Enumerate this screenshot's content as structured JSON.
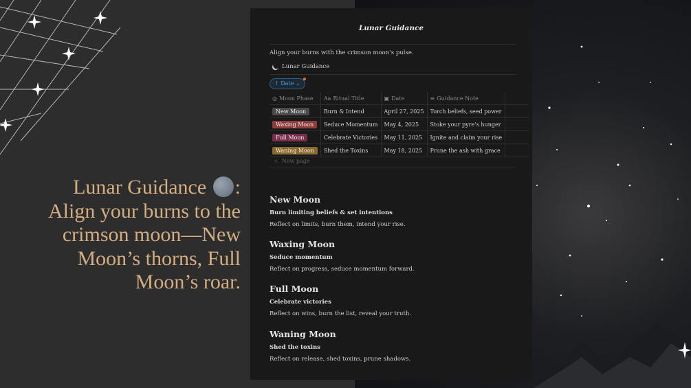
{
  "headline": {
    "line1": "Lunar Guidance",
    "line1_suffix": ":",
    "line2": "Align your burns to the",
    "line3": "crimson moon—New",
    "line4": "Moon’s thorns, Full",
    "line5": "Moon’s roar."
  },
  "panel": {
    "title": "Lunar Guidance",
    "description": "Align your burns with the crimson moon’s pulse.",
    "db_title": "Lunar Guidance",
    "filter_label": "↑ Date ⌄",
    "columns": [
      "Moon Phase",
      "Ritual Title",
      "Date",
      "Guidance Note"
    ],
    "column_icons": [
      "target-icon",
      "text-icon",
      "calendar-icon",
      "lines-icon"
    ],
    "rows": [
      {
        "phase": "New Moon",
        "phase_color": "#4a4a4a",
        "title": "Burn & Intend",
        "date": "April 27, 2025",
        "note": "Torch beliefs, seed power"
      },
      {
        "phase": "Waxing Moon",
        "phase_color": "#8f3b3b",
        "title": "Seduce Momentum",
        "date": "May 4, 2025",
        "note": "Stoke your pyre’s hunger"
      },
      {
        "phase": "Full Moon",
        "phase_color": "#7a2d4a",
        "title": "Celebrate Victories",
        "date": "May 11, 2025",
        "note": "Ignite and claim your rise"
      },
      {
        "phase": "Waning Moon",
        "phase_color": "#8a6a2c",
        "title": "Shed the Toxins",
        "date": "May 18, 2025",
        "note": "Prune the ash with grace"
      }
    ],
    "new_page": "New page",
    "sections": [
      {
        "heading": "New Moon",
        "sub": "Burn limiting beliefs & set intentions",
        "text": "Reflect on limits, burn them, intend your rise."
      },
      {
        "heading": "Waxing Moon",
        "sub": "Seduce momentum",
        "text": "Reflect on progress, seduce momentum forward."
      },
      {
        "heading": "Full Moon",
        "sub": "Celebrate victories",
        "text": "Reflect on wins, burn the list, reveal your truth."
      },
      {
        "heading": "Waning Moon",
        "sub": "Shed the toxins",
        "text": "Reflect on release, shed toxins, prune shadows."
      }
    ]
  }
}
